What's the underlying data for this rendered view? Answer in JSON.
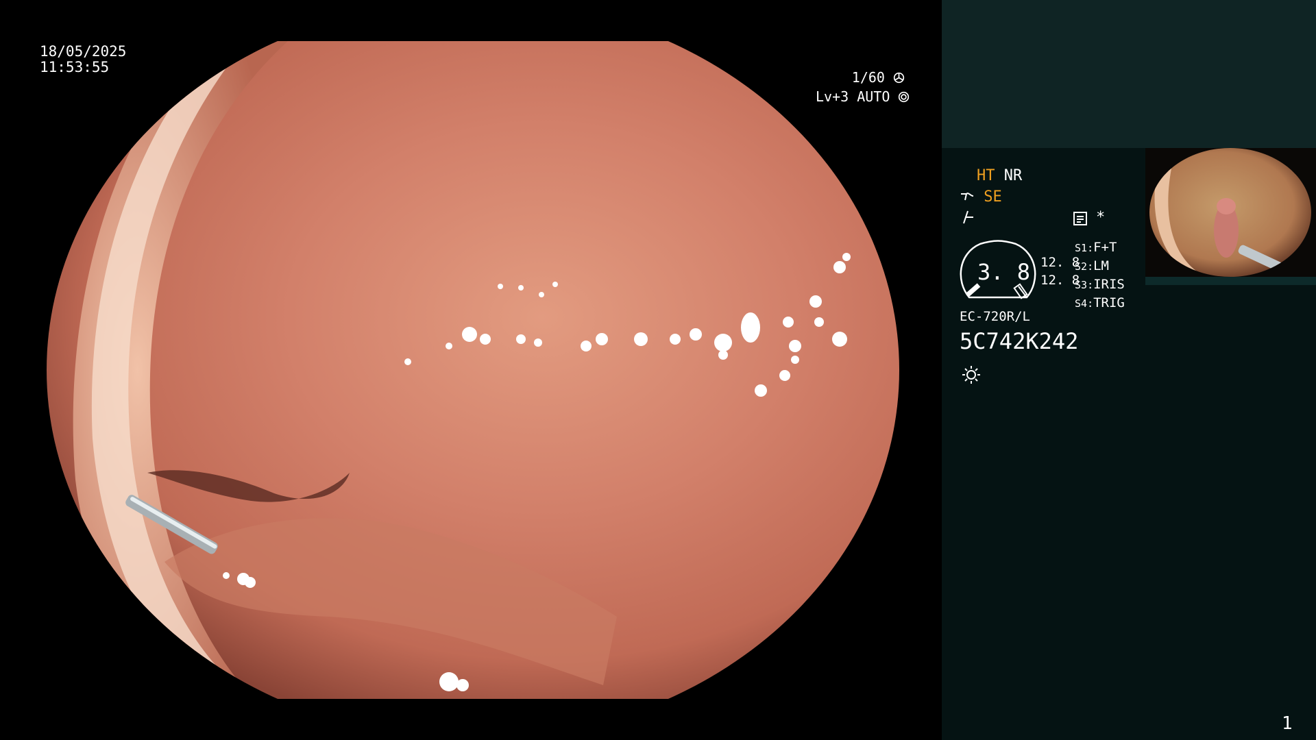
{
  "overlay": {
    "date": "18/05/2025",
    "time": "11:53:55",
    "shutter": "1/60",
    "level": "Lv+3 AUTO"
  },
  "panel": {
    "mode_ht": "HT",
    "mode_nr": "NR",
    "mode_se": "SE",
    "zoom_value": "3. 8",
    "left_values": [
      "12. 8",
      "12. 8"
    ],
    "settings": [
      {
        "key": "S1",
        "value": "F+T"
      },
      {
        "key": "S2",
        "value": "LM"
      },
      {
        "key": "S3",
        "value": "IRIS"
      },
      {
        "key": "S4",
        "value": "TRIG"
      }
    ],
    "scope_model": "EC-720R/L",
    "serial": "5C742K242",
    "asterisk": "*",
    "page_number": "1"
  },
  "colors": {
    "panel_bg": "#051313",
    "panel_top_bg": "#0f2424",
    "accent": "#f0a020",
    "mucosa": "#d9866a"
  },
  "icons": [
    "aperture-icon",
    "iris-icon",
    "scope-pump-icon",
    "flash-icon",
    "record-icon",
    "brightness-icon"
  ]
}
